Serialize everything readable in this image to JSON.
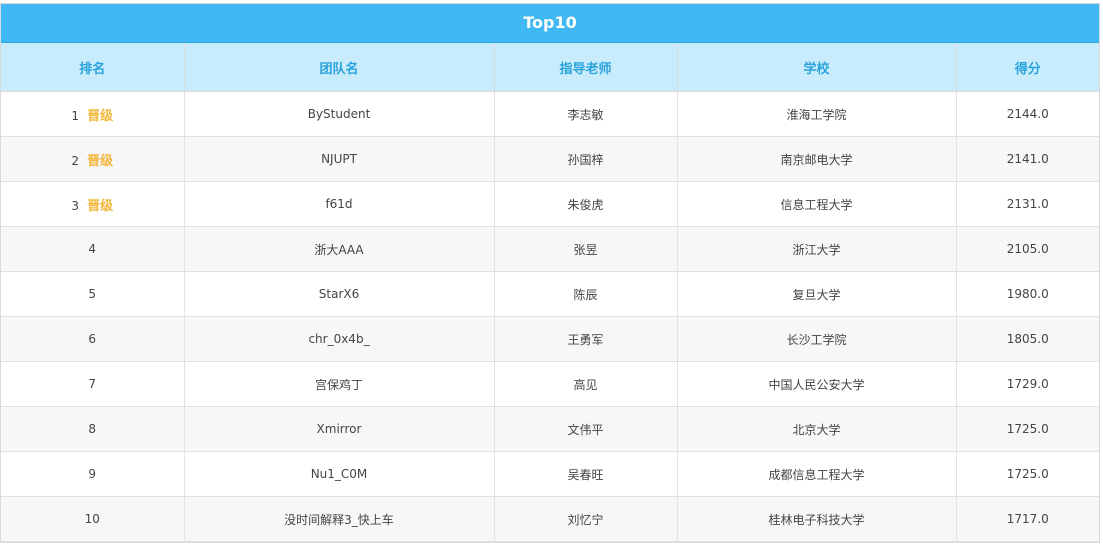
{
  "board": {
    "title": "Top10",
    "columns": {
      "rank": "排名",
      "team": "团队名",
      "tutor": "指导老师",
      "school": "学校",
      "score": "得分"
    },
    "rows": [
      {
        "rank": "1",
        "badge": "晋级",
        "team": "ByStudent",
        "tutor": "李志敏",
        "school": "淮海工学院",
        "score": "2144.0"
      },
      {
        "rank": "2",
        "badge": "晋级",
        "team": "NJUPT",
        "tutor": "孙国梓",
        "school": "南京邮电大学",
        "score": "2141.0"
      },
      {
        "rank": "3",
        "badge": "晋级",
        "team": "f61d",
        "tutor": "朱俊虎",
        "school": "信息工程大学",
        "score": "2131.0"
      },
      {
        "rank": "4",
        "badge": "",
        "team": "浙大AAA",
        "tutor": "张昱",
        "school": "浙江大学",
        "score": "2105.0"
      },
      {
        "rank": "5",
        "badge": "",
        "team": "StarX6",
        "tutor": "陈辰",
        "school": "复旦大学",
        "score": "1980.0"
      },
      {
        "rank": "6",
        "badge": "",
        "team": "chr_0x4b_",
        "tutor": "王勇军",
        "school": "长沙工学院",
        "score": "1805.0"
      },
      {
        "rank": "7",
        "badge": "",
        "team": "宫保鸡丁",
        "tutor": "高见",
        "school": "中国人民公安大学",
        "score": "1729.0"
      },
      {
        "rank": "8",
        "badge": "",
        "team": "Xmirror",
        "tutor": "文伟平",
        "school": "北京大学",
        "score": "1725.0"
      },
      {
        "rank": "9",
        "badge": "",
        "team": "Nu1_C0M",
        "tutor": "吴春旺",
        "school": "成都信息工程大学",
        "score": "1725.0"
      },
      {
        "rank": "10",
        "badge": "",
        "team": "没时间解释3_快上车",
        "tutor": "刘忆宁",
        "school": "桂林电子科技大学",
        "score": "1717.0"
      }
    ]
  },
  "colors": {
    "title_bg": "#3fb8f4",
    "header_bg": "#c8ecfb",
    "header_text": "#2aa3dc",
    "badge": "#f2b73b"
  }
}
